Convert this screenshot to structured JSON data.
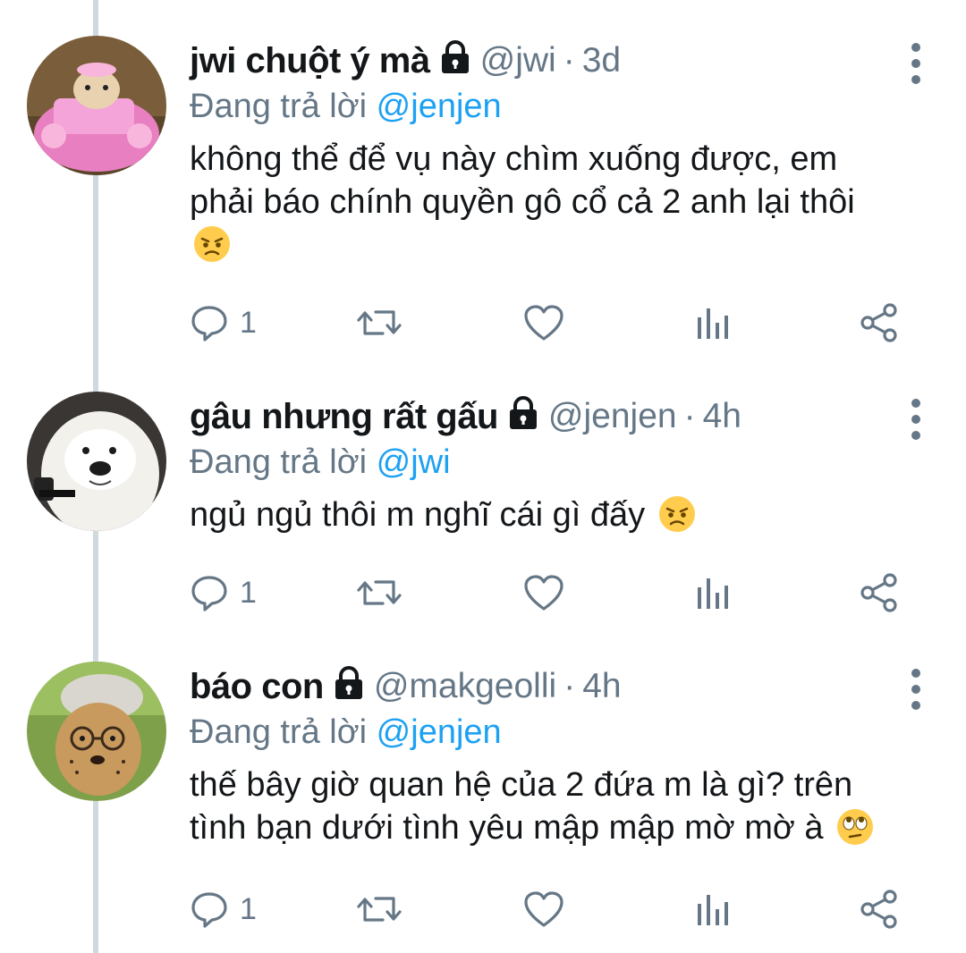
{
  "tweets": [
    {
      "name": "jwi chuột ý mà",
      "handle": "@jwi",
      "separator": "·",
      "time": "3d",
      "reply_prefix": "Đang trả lời ",
      "reply_to": "@jenjen",
      "text": "không thể để vụ này chìm xuống được, em\nphải báo chính quyền gô cổ cả 2 anh lại thôi\n",
      "emoji": "angry-face",
      "reply_count": "1"
    },
    {
      "name": "gâu nhưng rất gấu",
      "handle": "@jenjen",
      "separator": "·",
      "time": "4h",
      "reply_prefix": "Đang trả lời ",
      "reply_to": "@jwi",
      "text": "ngủ ngủ thôi m nghĩ cái gì đấy ",
      "emoji": "angry-face",
      "reply_count": "1"
    },
    {
      "name": "báo con",
      "handle": "@makgeolli",
      "separator": "·",
      "time": "4h",
      "reply_prefix": "Đang trả lời ",
      "reply_to": "@jenjen",
      "text": "thế bây giờ quan hệ của 2 đứa m là gì? trên\ntình bạn dưới tình yêu mập mập mờ mờ à ",
      "emoji": "eye-roll-face",
      "reply_count": "1"
    }
  ],
  "colors": {
    "text": "#14171a",
    "muted": "#657786",
    "mention": "#1da1f2",
    "thread_line": "#cfd9de",
    "emoji_yellow": "#ffcc4d"
  }
}
